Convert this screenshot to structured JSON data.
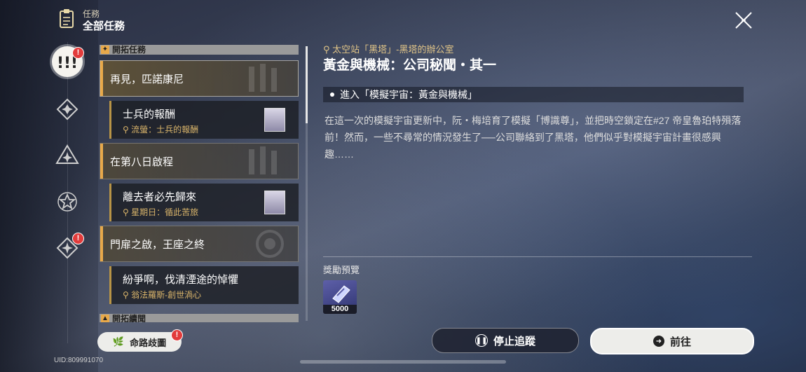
{
  "header": {
    "small": "任務",
    "title": "全部任務"
  },
  "rail": [
    {
      "name": "trailblaze",
      "badge": "!",
      "active": true
    },
    {
      "name": "companion",
      "badge": ""
    },
    {
      "name": "adventure",
      "badge": ""
    },
    {
      "name": "daily",
      "badge": ""
    },
    {
      "name": "event",
      "badge": "!"
    }
  ],
  "list": {
    "section1": "開拓任務",
    "section2": "開拓續聞",
    "quests": [
      {
        "title": "再見，匹諾康尼"
      },
      {
        "title": "士兵的報酬",
        "location": "流螢：士兵的報酬"
      },
      {
        "title": "在第八日啟程"
      },
      {
        "title": "離去者必先歸來",
        "location": "星期日：循此苦旅"
      },
      {
        "title": "門扉之啟，王座之終"
      },
      {
        "title": "紛爭啊，伐清湮途的悼懼",
        "location": "翁法羅斯-創世渦心"
      }
    ]
  },
  "detail": {
    "location": "太空站「黑塔」-黑塔的辦公室",
    "title": "黃金與機械：公司秘聞・其一",
    "objective": "進入「模擬宇宙：黃金與機械」",
    "description": "在這一次的模擬宇宙更新中，阮・梅培育了模擬「博識尊」，並把時空鎖定在#27 帝皇魯珀特殞落前！然而，一些不尋常的情況發生了──公司聯絡到了黑塔，他們似乎對模擬宇宙計畫很感興趣……",
    "reward_label": "獎勵預覽",
    "reward_qty": "5000"
  },
  "buttons": {
    "stop": "停止追蹤",
    "go": "前往",
    "fate": "命路歧圖",
    "fate_badge": "!"
  },
  "uid": "UID:809991070",
  "colors": {
    "accent_gold": "#e8a94a",
    "location_text": "#e0c487",
    "badge_red": "#e23b3b"
  }
}
